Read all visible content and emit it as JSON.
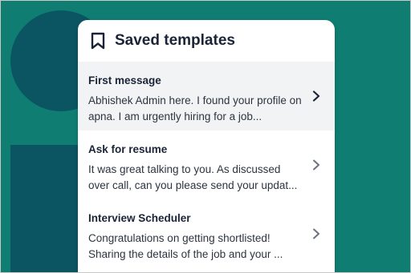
{
  "header": {
    "title": "Saved templates",
    "icon": "bookmark-icon"
  },
  "templates": [
    {
      "title": "First message",
      "body_line1": "Abhishek Admin here. I found your profile on",
      "body_line2": "apna. I am urgently hiring for a job...",
      "selected": true
    },
    {
      "title": "Ask for resume",
      "body_line1": "It was great talking to you. As discussed",
      "body_line2": "over call, can you please send your updat...",
      "selected": false
    },
    {
      "title": "Interview Scheduler",
      "body_line1": "Congratulations on getting shortlisted!",
      "body_line2": "Sharing the details of the job and your ...",
      "selected": false
    }
  ],
  "colors": {
    "background": "#0f7d72",
    "decoration": "#0b5563",
    "card": "#ffffff",
    "selected_row": "#f1f3f5",
    "text_dark": "#1b2437"
  }
}
